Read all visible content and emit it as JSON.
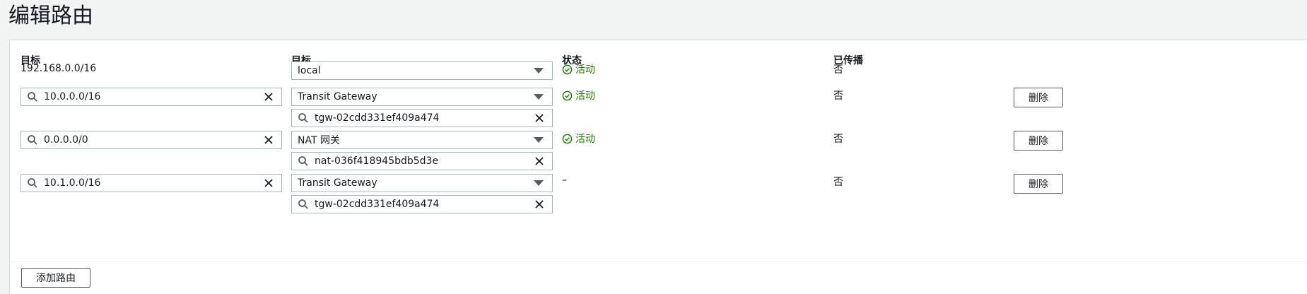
{
  "page": {
    "title": "编辑路由"
  },
  "columns": {
    "destination": "目标",
    "target": "目标",
    "status": "状态",
    "propagated": "已传播"
  },
  "routes": [
    {
      "destination": "192.168.0.0/16",
      "target_type": "local",
      "status": "活动",
      "propagated": "否"
    },
    {
      "destination": "10.0.0.0/16",
      "target_type": "Transit Gateway",
      "target_id": "tgw-02cdd331ef409a474",
      "status": "活动",
      "propagated": "否",
      "remove_label": "删除"
    },
    {
      "destination": "0.0.0.0/0",
      "target_type": "NAT 网关",
      "target_id": "nat-036f418945bdb5d3e",
      "status": "活动",
      "propagated": "否",
      "remove_label": "删除"
    },
    {
      "destination": "10.1.0.0/16",
      "target_type": "Transit Gateway",
      "target_id": "tgw-02cdd331ef409a474",
      "status": "–",
      "propagated": "否",
      "remove_label": "删除"
    }
  ],
  "actions": {
    "add_route": "添加路由"
  },
  "icons": {
    "search": "search-icon",
    "clear": "close-icon",
    "dropdown": "caret-down-icon",
    "status_ok": "check-circle-icon"
  },
  "colors": {
    "status_active": "#1d8102",
    "border": "#aab7b8"
  }
}
